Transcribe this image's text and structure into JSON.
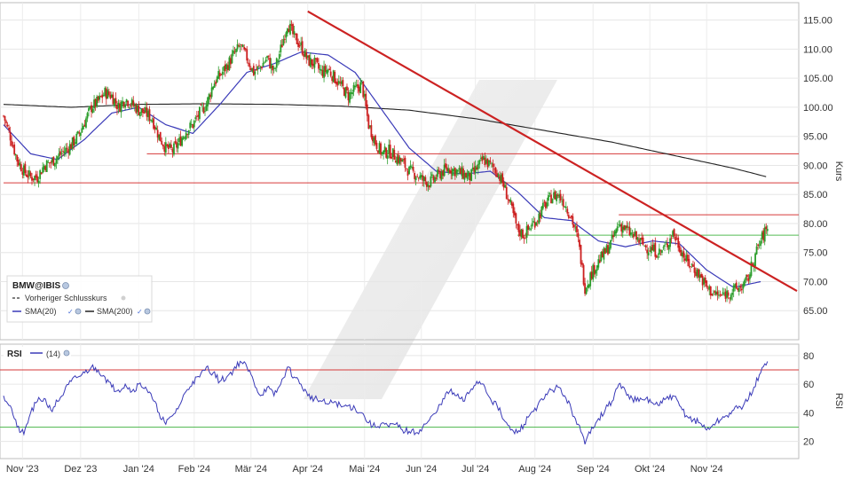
{
  "chart_data": [
    {
      "type": "candlestick",
      "symbol": "BMW@IBIS",
      "ylabel": "Kurs",
      "ylim": [
        60,
        118
      ],
      "yticks": [
        65,
        70,
        75,
        80,
        85,
        90,
        95,
        100,
        105,
        110,
        115
      ],
      "ytick_labels": [
        "65.00",
        "70.00",
        "75.00",
        "80.00",
        "85.00",
        "90.00",
        "95.00",
        "100.00",
        "105.00",
        "110.00",
        "115.00"
      ],
      "xticks": [
        "Nov '23",
        "Dez '23",
        "Jan '24",
        "Feb '24",
        "Mär '24",
        "Apr '24",
        "Mai '24",
        "Jun '24",
        "Jul '24",
        "Aug '24",
        "Sep '24",
        "Okt '24",
        "Nov '24"
      ],
      "grid": true,
      "legend": {
        "placement": "bottom-left",
        "title": "BMW@IBIS",
        "entries": [
          "Vorheriger Schlusskurs",
          "SMA(20)",
          "SMA(200)"
        ]
      },
      "colors": {
        "up": "#2a9d2a",
        "down": "#cc1f1f",
        "sma20": "#3a3ab8",
        "sma200": "#222222",
        "trend": "#cc2222",
        "support_red": "#d63a3a",
        "support_green": "#55bb55"
      },
      "close": [
        [
          0,
          98.5
        ],
        [
          5,
          95.0
        ],
        [
          10,
          91.0
        ],
        [
          15,
          89.0
        ],
        [
          20,
          88.0
        ],
        [
          25,
          88.0
        ],
        [
          30,
          90.0
        ],
        [
          35,
          90.5
        ],
        [
          40,
          91.5
        ],
        [
          45,
          92.5
        ],
        [
          50,
          93.5
        ],
        [
          55,
          95.0
        ],
        [
          60,
          97.5
        ],
        [
          65,
          100.0
        ],
        [
          70,
          101.0
        ],
        [
          75,
          102.5
        ],
        [
          80,
          102.0
        ],
        [
          85,
          100.0
        ],
        [
          90,
          101.5
        ],
        [
          95,
          100.5
        ],
        [
          100,
          99.5
        ],
        [
          105,
          99.0
        ],
        [
          110,
          98.0
        ],
        [
          115,
          95.0
        ],
        [
          120,
          93.0
        ],
        [
          125,
          92.5
        ],
        [
          130,
          94.0
        ],
        [
          135,
          96.0
        ],
        [
          140,
          97.0
        ],
        [
          145,
          99.0
        ],
        [
          150,
          100.5
        ],
        [
          155,
          104.0
        ],
        [
          160,
          105.5
        ],
        [
          165,
          107.0
        ],
        [
          170,
          109.0
        ],
        [
          175,
          110.5
        ],
        [
          180,
          108.5
        ],
        [
          185,
          106.0
        ],
        [
          190,
          107.0
        ],
        [
          195,
          108.5
        ],
        [
          200,
          106.0
        ],
        [
          205,
          110.0
        ],
        [
          210,
          114.5
        ],
        [
          215,
          112.0
        ],
        [
          220,
          110.5
        ],
        [
          225,
          108.0
        ],
        [
          230,
          107.5
        ],
        [
          235,
          106.0
        ],
        [
          240,
          106.5
        ],
        [
          245,
          105.0
        ],
        [
          250,
          103.5
        ],
        [
          255,
          102.0
        ],
        [
          260,
          103.0
        ],
        [
          265,
          104.0
        ],
        [
          270,
          97.0
        ],
        [
          275,
          94.0
        ],
        [
          280,
          92.0
        ],
        [
          285,
          92.5
        ],
        [
          290,
          91.5
        ],
        [
          295,
          90.5
        ],
        [
          300,
          89.0
        ],
        [
          305,
          88.5
        ],
        [
          310,
          87.5
        ],
        [
          315,
          87.0
        ],
        [
          320,
          88.0
        ],
        [
          325,
          89.0
        ],
        [
          330,
          89.5
        ],
        [
          335,
          89.0
        ],
        [
          340,
          88.5
        ],
        [
          345,
          88.0
        ],
        [
          350,
          89.5
        ],
        [
          355,
          91.0
        ],
        [
          360,
          90.0
        ],
        [
          365,
          89.0
        ],
        [
          370,
          86.5
        ],
        [
          375,
          83.0
        ],
        [
          380,
          79.0
        ],
        [
          385,
          78.0
        ],
        [
          390,
          79.5
        ],
        [
          395,
          81.0
        ],
        [
          400,
          83.0
        ],
        [
          405,
          84.5
        ],
        [
          410,
          85.0
        ],
        [
          415,
          83.5
        ],
        [
          420,
          81.0
        ],
        [
          425,
          77.0
        ],
        [
          430,
          69.0
        ],
        [
          435,
          71.5
        ],
        [
          440,
          73.5
        ],
        [
          445,
          75.0
        ],
        [
          450,
          77.0
        ],
        [
          455,
          80.0
        ],
        [
          460,
          79.0
        ],
        [
          465,
          78.0
        ],
        [
          470,
          77.0
        ],
        [
          475,
          76.0
        ],
        [
          480,
          75.5
        ],
        [
          485,
          75.0
        ],
        [
          490,
          76.0
        ],
        [
          495,
          78.5
        ],
        [
          500,
          76.0
        ],
        [
          505,
          73.5
        ],
        [
          510,
          72.5
        ],
        [
          515,
          71.0
        ],
        [
          520,
          69.0
        ],
        [
          525,
          68.0
        ],
        [
          530,
          67.5
        ],
        [
          535,
          68.0
        ],
        [
          540,
          68.5
        ],
        [
          545,
          69.0
        ],
        [
          550,
          70.0
        ],
        [
          555,
          74.0
        ],
        [
          560,
          77.0
        ],
        [
          565,
          79.5
        ]
      ],
      "sma20": [
        [
          0,
          97.0
        ],
        [
          20,
          92.0
        ],
        [
          40,
          91.0
        ],
        [
          60,
          94.5
        ],
        [
          80,
          99.0
        ],
        [
          100,
          100.0
        ],
        [
          120,
          97.0
        ],
        [
          140,
          95.5
        ],
        [
          160,
          100.5
        ],
        [
          180,
          106.0
        ],
        [
          200,
          107.5
        ],
        [
          220,
          109.5
        ],
        [
          240,
          109.0
        ],
        [
          260,
          106.0
        ],
        [
          280,
          99.5
        ],
        [
          300,
          93.0
        ],
        [
          320,
          89.0
        ],
        [
          340,
          88.5
        ],
        [
          360,
          89.0
        ],
        [
          380,
          85.5
        ],
        [
          400,
          81.0
        ],
        [
          420,
          80.5
        ],
        [
          440,
          77.0
        ],
        [
          460,
          76.0
        ],
        [
          480,
          77.0
        ],
        [
          500,
          76.5
        ],
        [
          520,
          72.0
        ],
        [
          540,
          69.0
        ],
        [
          560,
          70.0
        ]
      ],
      "sma200": [
        [
          0,
          100.5
        ],
        [
          50,
          100.0
        ],
        [
          100,
          100.5
        ],
        [
          150,
          100.6
        ],
        [
          200,
          100.5
        ],
        [
          250,
          100.2
        ],
        [
          300,
          99.5
        ],
        [
          350,
          98.0
        ],
        [
          400,
          96.0
        ],
        [
          450,
          94.0
        ],
        [
          500,
          91.5
        ],
        [
          540,
          89.5
        ],
        [
          565,
          88.0
        ]
      ],
      "trendline": [
        [
          225,
          116.5
        ],
        [
          575,
          69.0
        ]
      ],
      "support_lines": [
        {
          "level": 87.0,
          "x_range": [
            0,
            575
          ],
          "color": "red"
        },
        {
          "level": 92.0,
          "x_range": [
            106,
            575
          ],
          "color": "red"
        },
        {
          "level": 81.5,
          "x_range": [
            455,
            575
          ],
          "color": "red"
        },
        {
          "level": 78.0,
          "x_range": [
            380,
            575
          ],
          "color": "green"
        }
      ]
    },
    {
      "type": "line",
      "indicator": "RSI",
      "legend_label": "(14)",
      "ylabel": "RSI",
      "ylim": [
        8,
        88
      ],
      "yticks": [
        20,
        40,
        60,
        80
      ],
      "ytick_labels": [
        "20",
        "40",
        "60",
        "80"
      ],
      "bands": [
        30,
        70
      ],
      "grid": true,
      "series": [
        [
          0,
          52
        ],
        [
          5,
          45
        ],
        [
          10,
          30
        ],
        [
          15,
          25
        ],
        [
          20,
          40
        ],
        [
          25,
          48
        ],
        [
          30,
          50
        ],
        [
          35,
          42
        ],
        [
          40,
          48
        ],
        [
          45,
          55
        ],
        [
          50,
          62
        ],
        [
          55,
          65
        ],
        [
          60,
          68
        ],
        [
          65,
          72
        ],
        [
          70,
          70
        ],
        [
          75,
          65
        ],
        [
          80,
          58
        ],
        [
          85,
          56
        ],
        [
          90,
          60
        ],
        [
          95,
          55
        ],
        [
          100,
          60
        ],
        [
          105,
          58
        ],
        [
          110,
          50
        ],
        [
          115,
          40
        ],
        [
          120,
          32
        ],
        [
          125,
          38
        ],
        [
          130,
          45
        ],
        [
          135,
          55
        ],
        [
          140,
          62
        ],
        [
          145,
          65
        ],
        [
          150,
          72
        ],
        [
          155,
          68
        ],
        [
          160,
          62
        ],
        [
          165,
          65
        ],
        [
          170,
          70
        ],
        [
          175,
          76
        ],
        [
          180,
          72
        ],
        [
          185,
          62
        ],
        [
          190,
          52
        ],
        [
          195,
          58
        ],
        [
          200,
          52
        ],
        [
          205,
          60
        ],
        [
          210,
          72
        ],
        [
          215,
          65
        ],
        [
          220,
          60
        ],
        [
          225,
          52
        ],
        [
          230,
          50
        ],
        [
          235,
          48
        ],
        [
          240,
          46
        ],
        [
          245,
          48
        ],
        [
          250,
          44
        ],
        [
          255,
          45
        ],
        [
          260,
          43
        ],
        [
          265,
          40
        ],
        [
          270,
          33
        ],
        [
          275,
          30
        ],
        [
          280,
          33
        ],
        [
          285,
          30
        ],
        [
          290,
          32
        ],
        [
          295,
          28
        ],
        [
          300,
          27
        ],
        [
          305,
          26
        ],
        [
          310,
          30
        ],
        [
          315,
          35
        ],
        [
          320,
          40
        ],
        [
          325,
          50
        ],
        [
          330,
          55
        ],
        [
          335,
          52
        ],
        [
          340,
          48
        ],
        [
          345,
          55
        ],
        [
          350,
          62
        ],
        [
          355,
          60
        ],
        [
          360,
          50
        ],
        [
          365,
          45
        ],
        [
          370,
          35
        ],
        [
          375,
          28
        ],
        [
          380,
          26
        ],
        [
          385,
          32
        ],
        [
          390,
          40
        ],
        [
          395,
          45
        ],
        [
          400,
          50
        ],
        [
          405,
          56
        ],
        [
          410,
          58
        ],
        [
          415,
          52
        ],
        [
          420,
          42
        ],
        [
          425,
          32
        ],
        [
          430,
          18
        ],
        [
          435,
          30
        ],
        [
          440,
          36
        ],
        [
          445,
          42
        ],
        [
          450,
          48
        ],
        [
          455,
          60
        ],
        [
          460,
          55
        ],
        [
          465,
          50
        ],
        [
          470,
          48
        ],
        [
          475,
          50
        ],
        [
          480,
          47
        ],
        [
          485,
          45
        ],
        [
          490,
          50
        ],
        [
          495,
          52
        ],
        [
          500,
          45
        ],
        [
          505,
          38
        ],
        [
          510,
          35
        ],
        [
          515,
          33
        ],
        [
          520,
          28
        ],
        [
          525,
          32
        ],
        [
          530,
          35
        ],
        [
          535,
          38
        ],
        [
          540,
          42
        ],
        [
          545,
          44
        ],
        [
          550,
          48
        ],
        [
          555,
          58
        ],
        [
          560,
          68
        ],
        [
          565,
          76
        ]
      ]
    }
  ]
}
